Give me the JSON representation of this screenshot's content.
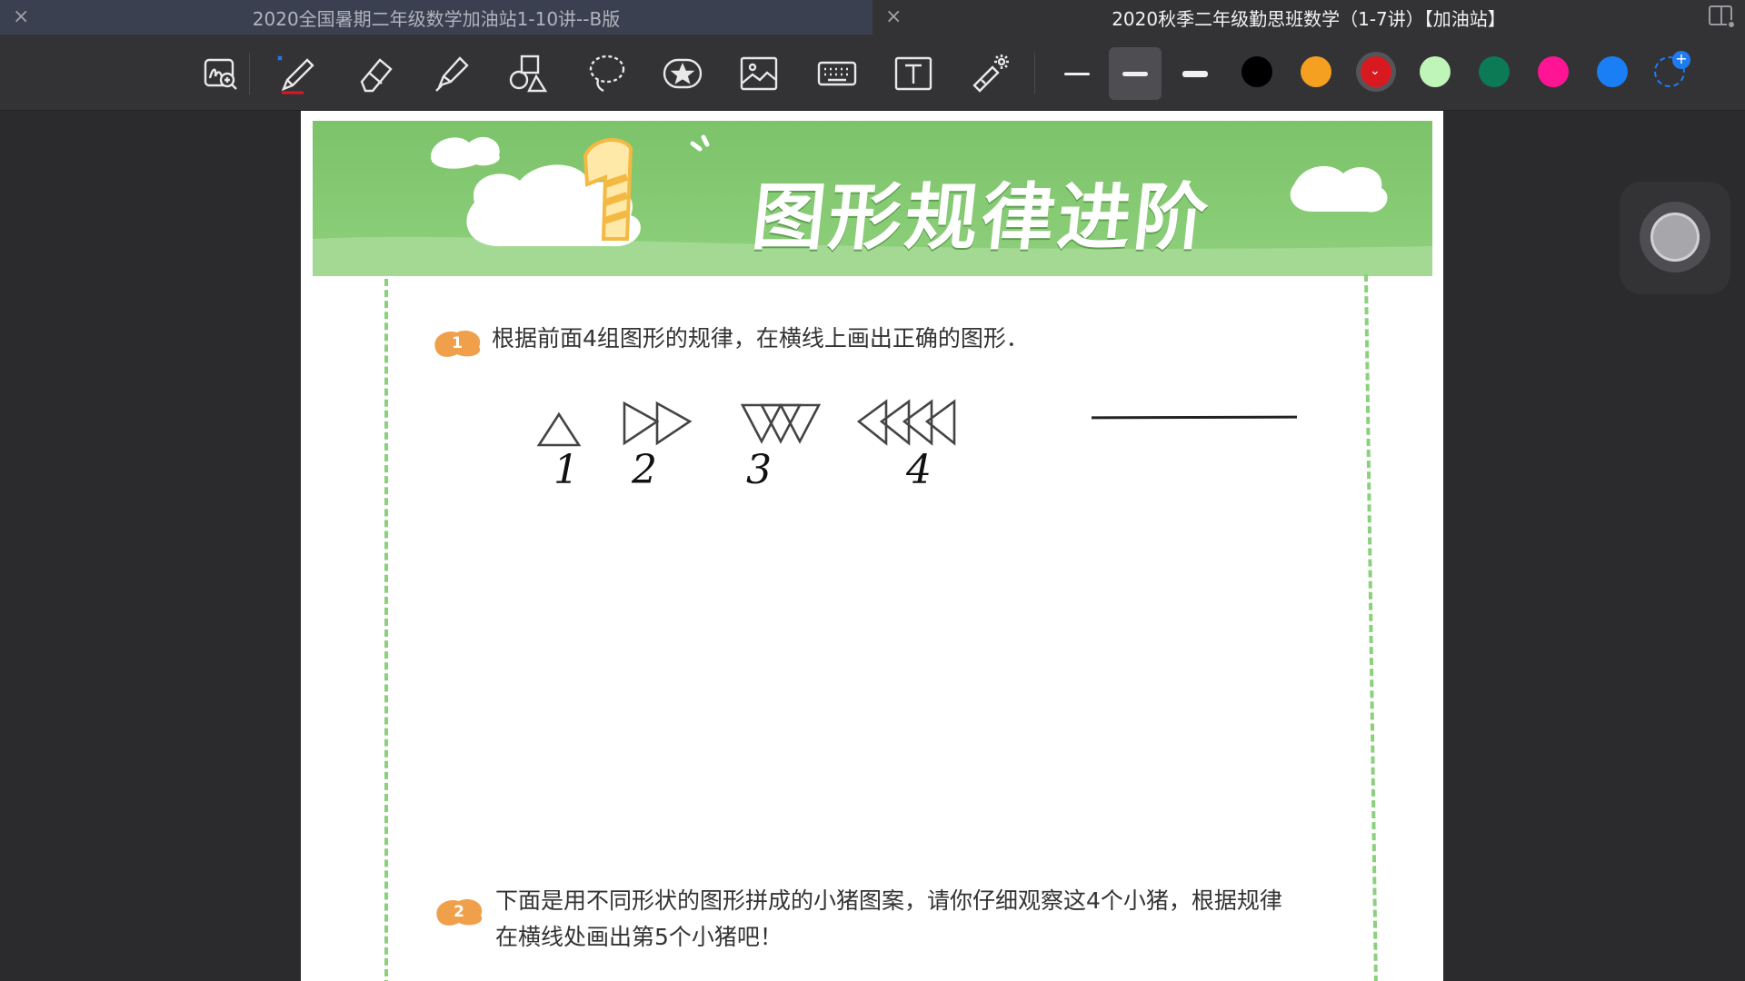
{
  "tabs": [
    {
      "title": "2020全国暑期二年级数学加油站1-10讲--B版",
      "active": false
    },
    {
      "title": "2020秋季二年级勤思班数学（1-7讲）【加油站】",
      "active": true
    }
  ],
  "toolbar": {
    "tools": [
      "zoom-write-icon",
      "pen-icon",
      "eraser-icon",
      "highlighter-icon",
      "shapes-icon",
      "lasso-icon",
      "sticker-icon",
      "image-icon",
      "keyboard-icon",
      "text-box-icon",
      "laser-pointer-icon"
    ],
    "stroke_widths": [
      "thin",
      "medium",
      "thick"
    ],
    "selected_stroke": "medium",
    "colors": [
      "#000000",
      "#f5a020",
      "#d81920",
      "#bff5b8",
      "#0b7a55",
      "#ff1493",
      "#1a7ff5"
    ],
    "selected_color": "#d81920"
  },
  "page": {
    "banner_title": "图形规律进阶",
    "banner_number": "1",
    "q1": {
      "badge": "1",
      "text": "根据前面4组图形的规律，在横线上画出正确的图形．",
      "handwritten_numbers": [
        "1",
        "2",
        "3",
        "4"
      ]
    },
    "q2": {
      "badge": "2",
      "line1": "下面是用不同形状的图形拼成的小猪图案，请你仔细观察这4个小猪，根据规律",
      "line2": "在横线处画出第5个小猪吧！"
    }
  }
}
